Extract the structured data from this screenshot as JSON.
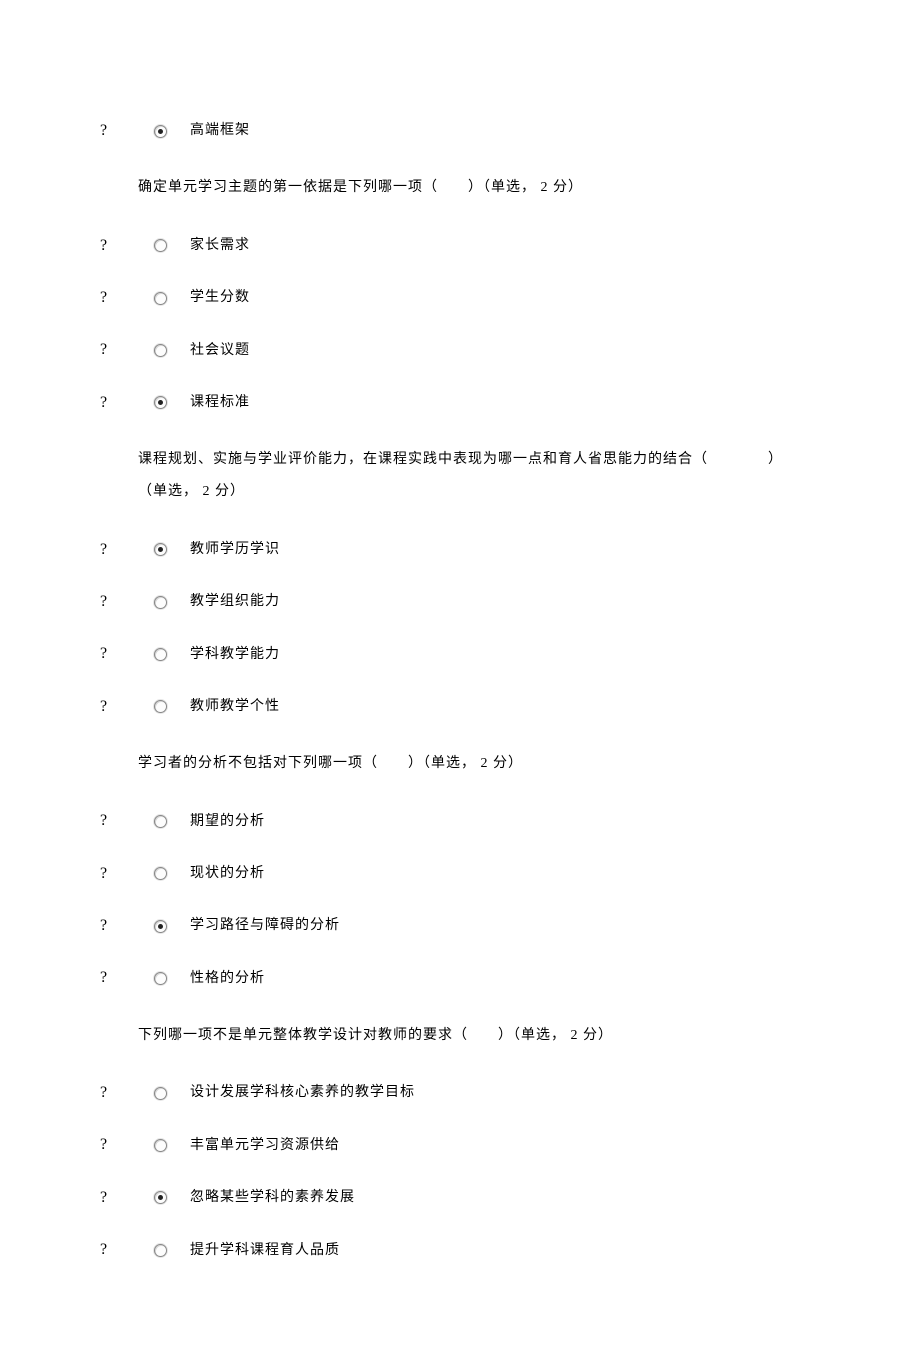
{
  "bullet": "?",
  "blocks": [
    {
      "question": null,
      "options": [
        {
          "label": "高端框架",
          "selected": true
        }
      ]
    },
    {
      "question": "确定单元学习主题的第一依据是下列哪一项（　　）（单选，  2  分）",
      "options": [
        {
          "label": "家长需求",
          "selected": false
        },
        {
          "label": "学生分数",
          "selected": false
        },
        {
          "label": "社会议题",
          "selected": false
        },
        {
          "label": "课程标准",
          "selected": true
        }
      ]
    },
    {
      "question": "课程规划、实施与学业评价能力，在课程实践中表现为哪一点和育人省思能力的结合（　　　　）\n（单选，  2 分）",
      "options": [
        {
          "label": "教师学历学识",
          "selected": true
        },
        {
          "label": "教学组织能力",
          "selected": false
        },
        {
          "label": "学科教学能力",
          "selected": false
        },
        {
          "label": "教师教学个性",
          "selected": false
        }
      ]
    },
    {
      "question": "学习者的分析不包括对下列哪一项（　　）（单选，  2  分）",
      "options": [
        {
          "label": "期望的分析",
          "selected": false
        },
        {
          "label": "现状的分析",
          "selected": false
        },
        {
          "label": "学习路径与障碍的分析",
          "selected": true
        },
        {
          "label": "性格的分析",
          "selected": false
        }
      ]
    },
    {
      "question": "下列哪一项不是单元整体教学设计对教师的要求（　　）（单选，  2 分）",
      "options": [
        {
          "label": "设计发展学科核心素养的教学目标",
          "selected": false
        },
        {
          "label": "丰富单元学习资源供给",
          "selected": false
        },
        {
          "label": "忽略某些学科的素养发展",
          "selected": true
        },
        {
          "label": "提升学科课程育人品质",
          "selected": false
        }
      ]
    }
  ]
}
